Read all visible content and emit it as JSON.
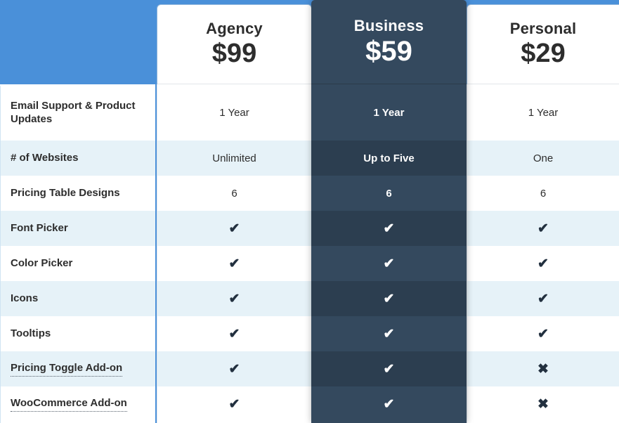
{
  "theme": {
    "banner_blue": "#4a90d9",
    "featured_dark": "#34495e",
    "featured_dark_alt": "#2c3e50",
    "row_alt_light": "#e6f2f8",
    "text_dark": "#2d2d2d"
  },
  "icons": {
    "check": "✔",
    "cross": "✖"
  },
  "features": [
    {
      "label": "Email Support & Product Updates",
      "tooltip": false
    },
    {
      "label": "# of Websites",
      "tooltip": false
    },
    {
      "label": "Pricing Table Designs",
      "tooltip": false
    },
    {
      "label": "Font Picker",
      "tooltip": false
    },
    {
      "label": "Color Picker",
      "tooltip": false
    },
    {
      "label": "Icons",
      "tooltip": false
    },
    {
      "label": "Tooltips",
      "tooltip": false
    },
    {
      "label": "Pricing Toggle Add-on",
      "tooltip": true
    },
    {
      "label": "WooCommerce Add-on",
      "tooltip": true
    }
  ],
  "plans": [
    {
      "name": "Agency",
      "price": "$99",
      "featured": false,
      "values": [
        "1 Year",
        "Unlimited",
        "6",
        "check",
        "check",
        "check",
        "check",
        "check",
        "check"
      ]
    },
    {
      "name": "Business",
      "price": "$59",
      "featured": true,
      "values": [
        "1 Year",
        "Up to Five",
        "6",
        "check",
        "check",
        "check",
        "check",
        "check",
        "check"
      ]
    },
    {
      "name": "Personal",
      "price": "$29",
      "featured": false,
      "values": [
        "1 Year",
        "One",
        "6",
        "check",
        "check",
        "check",
        "check",
        "cross",
        "cross"
      ]
    }
  ]
}
